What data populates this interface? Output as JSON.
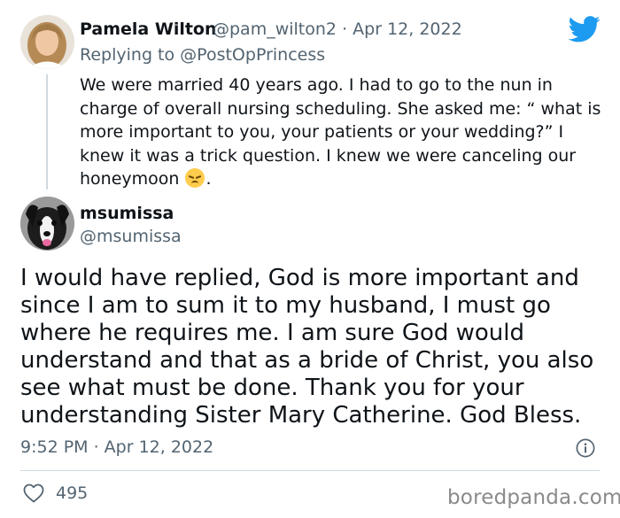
{
  "reply_tweet": {
    "author_name": "Pamela Wilton",
    "author_handle": "@pam_wilton2",
    "separator": "·",
    "date": "Apr 12, 2022",
    "replying_to_label": "Replying to",
    "replying_to_handle": "@PostOpPrincess",
    "text": "We were married 40 years ago. I had to go to the nun in charge of overall nursing scheduling. She asked me: “ what is more important to you, your patients or your wedding?” I knew it was a trick question. I knew we were canceling our honeymoon",
    "text_end": ".",
    "emoji": "disappointed-face"
  },
  "main_tweet": {
    "author_name": "msumissa",
    "author_handle": "@msumissa",
    "text": "I would have replied, God is more important and since I am to sum it to my husband, I must go where he requires me. I am sure God would understand and that as a bride of Christ, you also see what must be done. Thank you for your understanding Sister Mary Catherine.  God Bless.",
    "timestamp": "9:52 PM · Apr 12, 2022",
    "likes": "495"
  },
  "watermark": "boredpanda.com",
  "colors": {
    "twitter_blue": "#1d9bf0",
    "text_primary": "#0f1419",
    "text_secondary": "#536471",
    "divider": "#cfd9de"
  },
  "icons": [
    "twitter-bird-icon",
    "info-icon",
    "heart-icon",
    "disappointed-face-emoji"
  ]
}
